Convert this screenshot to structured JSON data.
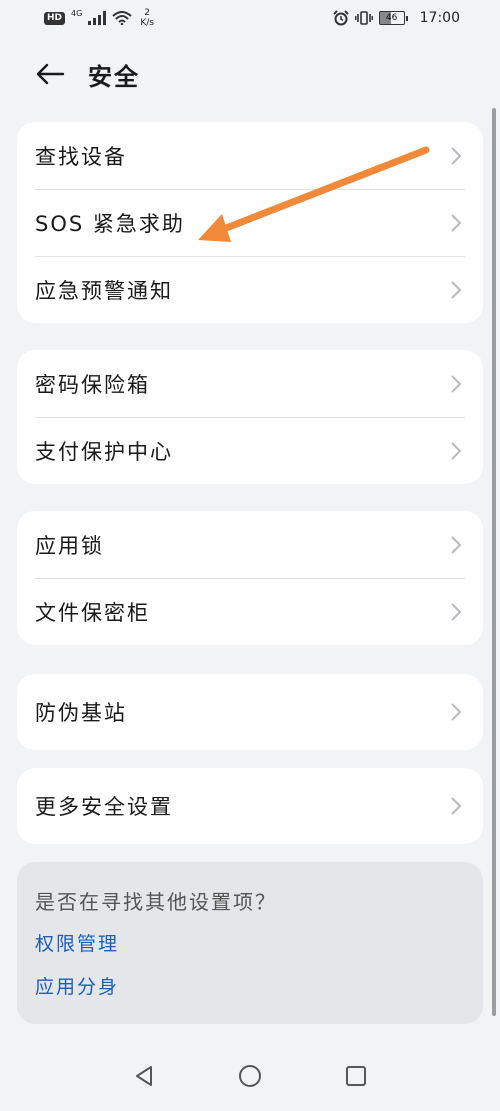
{
  "status_bar": {
    "hd": "HD",
    "network": "4G",
    "speed_value": "2",
    "speed_unit": "K/s",
    "battery": "46",
    "time": "17:00"
  },
  "header": {
    "title": "安全"
  },
  "groups": [
    {
      "items": [
        {
          "label": "查找设备"
        },
        {
          "label": "SOS 紧急求助"
        },
        {
          "label": "应急预警通知"
        }
      ]
    },
    {
      "items": [
        {
          "label": "密码保险箱"
        },
        {
          "label": "支付保护中心"
        }
      ]
    },
    {
      "items": [
        {
          "label": "应用锁"
        },
        {
          "label": "文件保密柜"
        }
      ]
    },
    {
      "items": [
        {
          "label": "防伪基站"
        }
      ]
    },
    {
      "items": [
        {
          "label": "更多安全设置"
        }
      ]
    }
  ],
  "suggestions": {
    "title": "是否在寻找其他设置项？",
    "links": [
      {
        "label": "权限管理"
      },
      {
        "label": "应用分身"
      }
    ]
  },
  "colors": {
    "background": "#f1f3f5",
    "card": "#ffffff",
    "link": "#1c5fb9",
    "annotation_arrow": "#f08a3a"
  },
  "icons": {
    "back": "arrow-left-icon",
    "chevron": "chevron-right-icon",
    "nav_back": "triangle-back-icon",
    "nav_home": "circle-home-icon",
    "nav_recent": "square-recent-icon"
  }
}
